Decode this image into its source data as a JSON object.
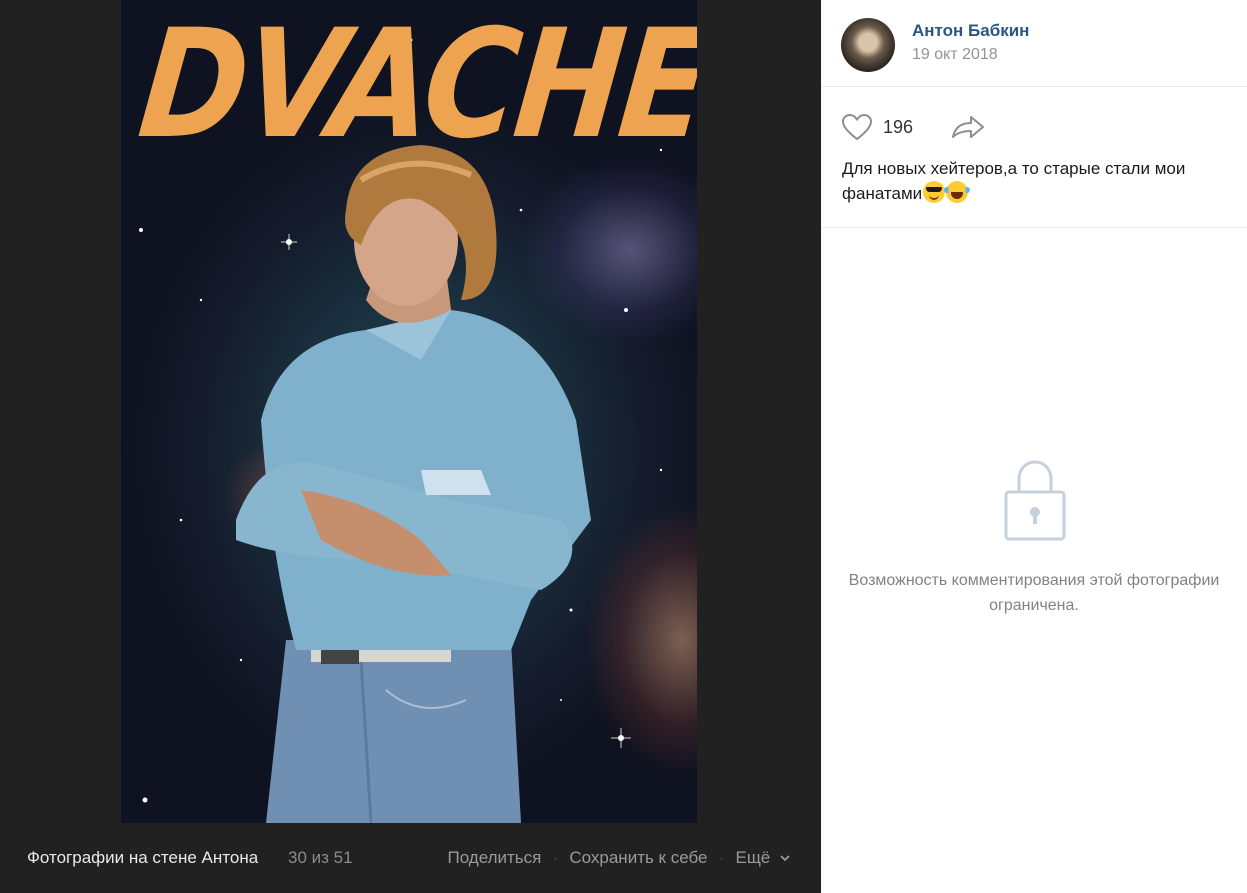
{
  "viewer": {
    "poster_title": "DVACHER",
    "album_title": "Фотографии на стене Антона",
    "counter": "30 из 51",
    "actions": {
      "share": "Поделиться",
      "save": "Сохранить к себе",
      "more": "Ещё"
    }
  },
  "post": {
    "author_name": "Антон Бабкин",
    "date": "19 окт 2018",
    "likes": "196",
    "caption": "Для новых хейтеров,а то старые стали мои фанатами"
  },
  "comments": {
    "locked_message": "Возможность комментирования этой фотографии ограничена."
  },
  "icons": {
    "like": "heart-icon",
    "share": "share-arrow-icon",
    "lock": "lock-icon",
    "more": "chevron-down-icon"
  },
  "colors": {
    "viewer_bg": "#212121",
    "author_link": "#2a5885",
    "poster_title": "#eea350",
    "shirt": "#7fb0cc"
  }
}
